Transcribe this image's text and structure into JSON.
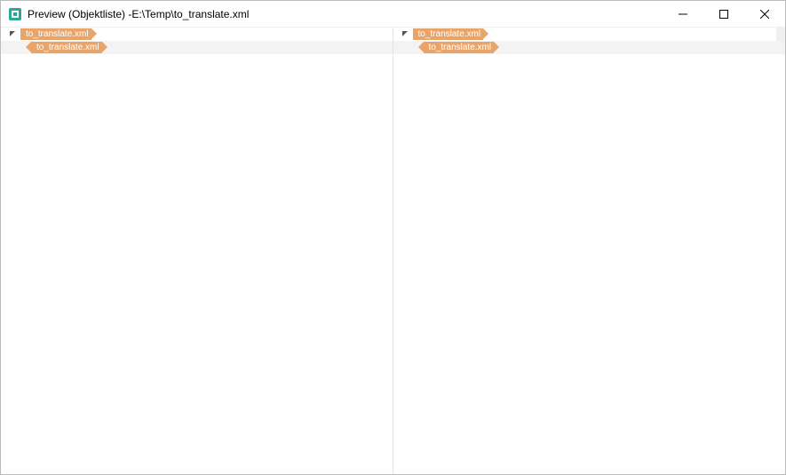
{
  "window": {
    "title": "Preview (Objektliste) -E:\\Temp\\to_translate.xml"
  },
  "panes": {
    "left": {
      "root_tag": "to_translate.xml",
      "child_tag": "to_translate.xml"
    },
    "right": {
      "root_tag": "to_translate.xml",
      "child_tag": "to_translate.xml"
    }
  },
  "colors": {
    "tag_bg": "#e9a569",
    "tag_fg": "#ffffff",
    "selected_row_bg": "#f3f3f3"
  }
}
